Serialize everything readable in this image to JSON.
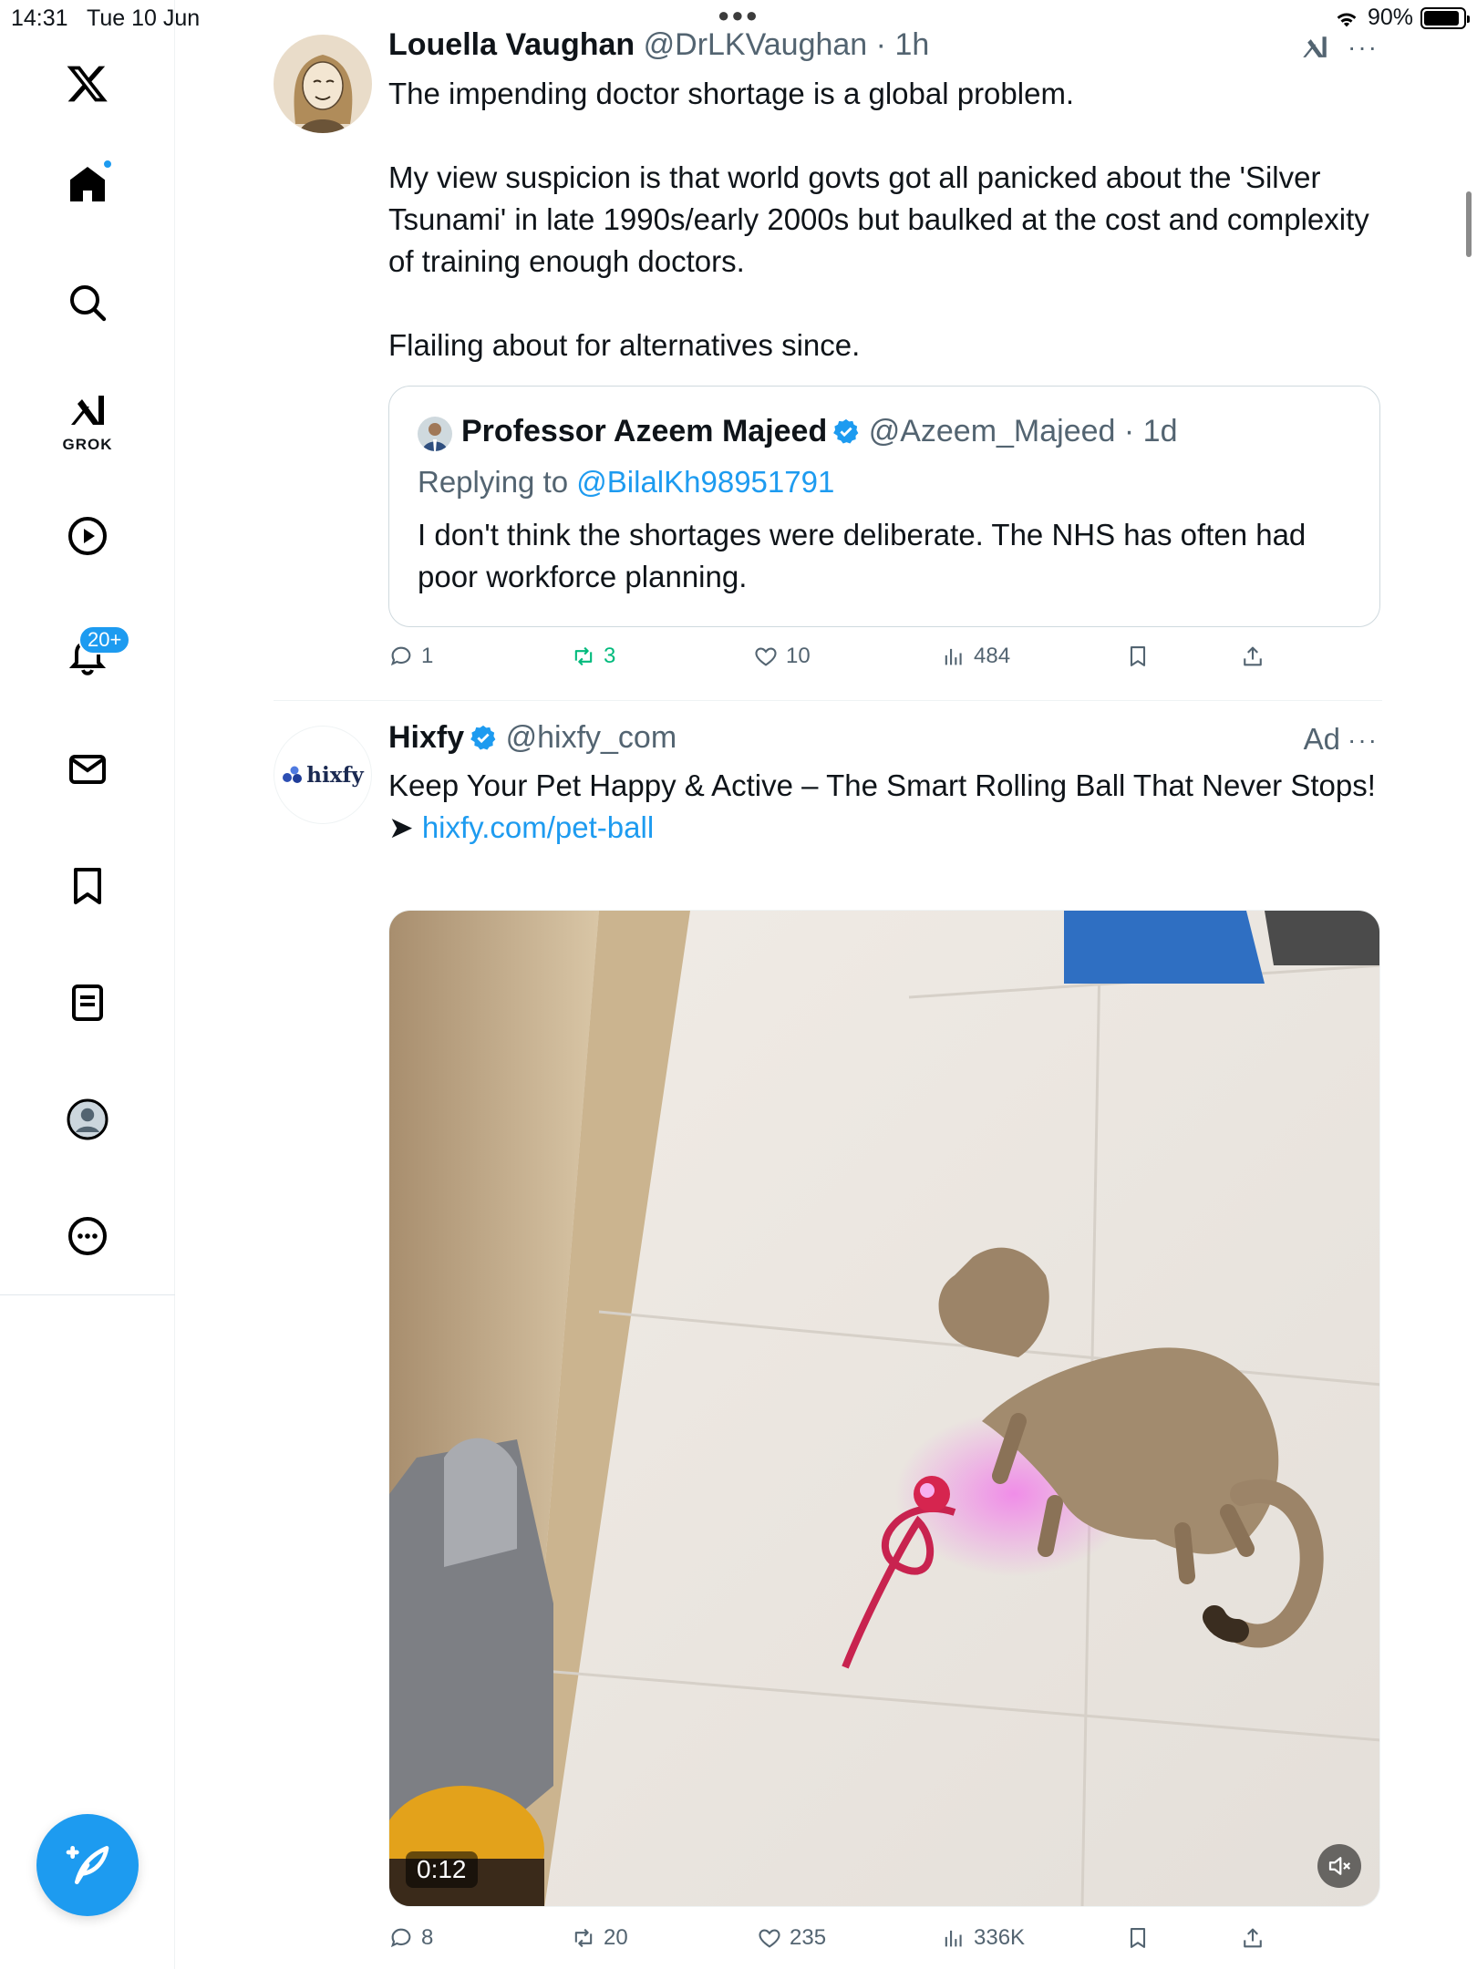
{
  "status_bar": {
    "time": "14:31",
    "date": "Tue 10 Jun",
    "battery_text": "90%",
    "battery_level": 0.9
  },
  "sidebar": {
    "items": [
      {
        "name": "home",
        "icon": "home-icon"
      },
      {
        "name": "search",
        "icon": "search-icon"
      },
      {
        "name": "grok",
        "icon": "grok-icon",
        "label": "GROK"
      },
      {
        "name": "videos",
        "icon": "play-icon"
      },
      {
        "name": "notifications",
        "icon": "bell-icon",
        "badge": "20+"
      },
      {
        "name": "messages",
        "icon": "mail-icon"
      },
      {
        "name": "bookmarks",
        "icon": "bookmark-icon"
      },
      {
        "name": "lists",
        "icon": "list-icon"
      },
      {
        "name": "profile",
        "icon": "avatar-icon"
      },
      {
        "name": "more",
        "icon": "more-circle-icon"
      }
    ],
    "compose_icon": "compose-icon"
  },
  "tweet1": {
    "name": "Louella Vaughan",
    "handle": "@DrLKVaughan",
    "time": "· 1h",
    "text": [
      "The impending doctor shortage is a global problem.",
      "",
      "My view suspicion is that world govts got all panicked about the 'Silver Tsunami' in late 1990s/early 2000s but baulked at the cost and complexity of training enough doctors.",
      "",
      "Flailing about for alternatives since."
    ],
    "quote": {
      "name": "Professor Azeem Majeed",
      "handle": "@Azeem_Majeed",
      "time": "· 1d",
      "replying_prefix": "Replying to ",
      "replying_to": "@BilalKh98951791",
      "text": "I don't think the shortages were deliberate. The NHS has often had poor workforce planning."
    },
    "stats": {
      "replies": "1",
      "reposts": "3",
      "likes": "10",
      "views": "484"
    }
  },
  "tweet2": {
    "name": "Hixfy",
    "handle": "@hixfy_com",
    "ad_label": "Ad",
    "avatar_text": "hixfy",
    "text_line1": "Keep Your Pet Happy & Active – The Smart Rolling Ball That Never Stops!",
    "arrow": "➤ ",
    "link": "hixfy.com/pet-ball",
    "video_time": "0:12",
    "stats": {
      "replies": "8",
      "reposts": "20",
      "likes": "235",
      "views": "336K"
    }
  },
  "colors": {
    "accent": "#1d9bf0",
    "repost_green": "#00ba7c",
    "muted_text": "#536471"
  }
}
